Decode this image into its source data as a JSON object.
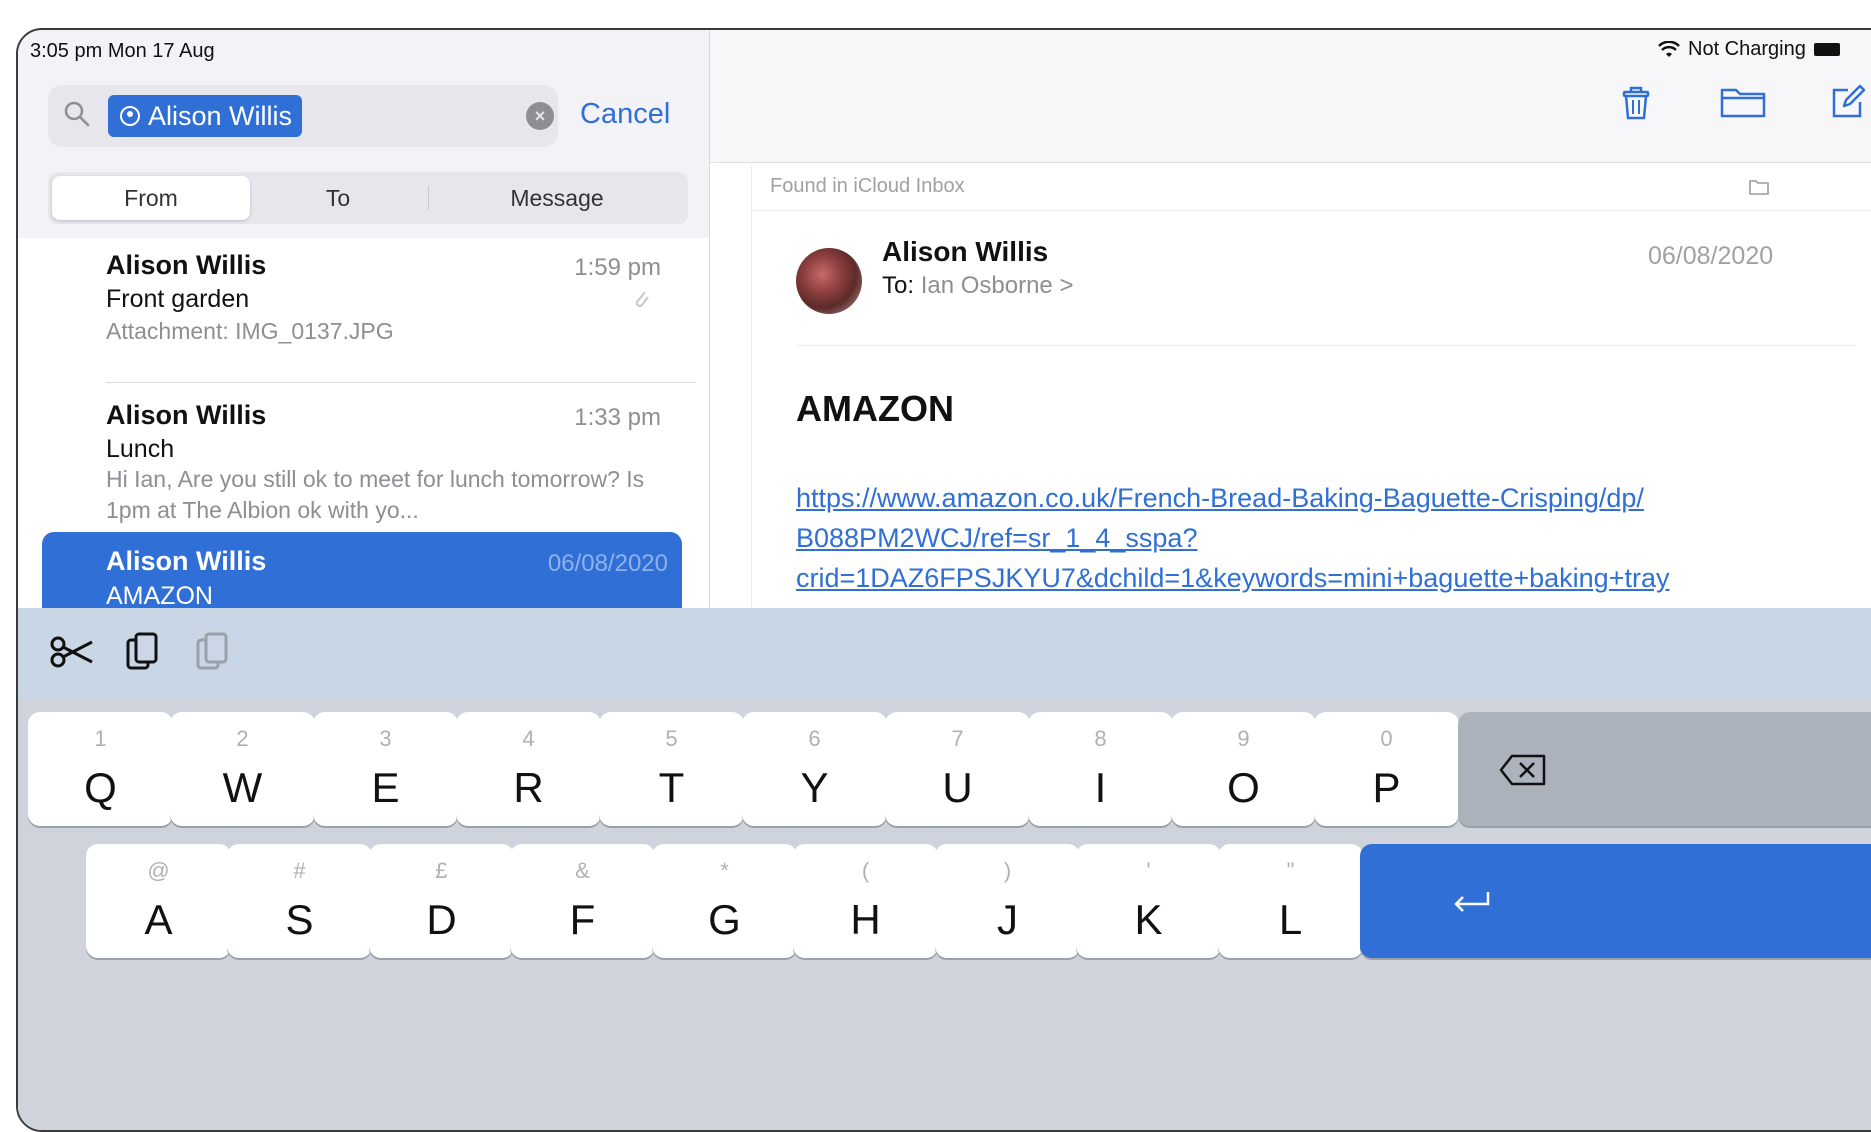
{
  "status_bar": {
    "time_date": "3:05 pm  Mon 17 Aug",
    "battery_text": "Not Charging"
  },
  "search": {
    "token_label": "Alison Willis",
    "cancel_label": "Cancel",
    "scopes": [
      "From",
      "To",
      "Message"
    ],
    "active_scope": "From"
  },
  "messages": [
    {
      "sender": "Alison Willis",
      "time": "1:59 pm",
      "subject": "Front garden",
      "preview": "Attachment: IMG_0137.JPG",
      "has_attachment": true
    },
    {
      "sender": "Alison Willis",
      "time": "1:33 pm",
      "subject": "Lunch",
      "preview": "Hi Ian, Are you still ok to meet for lunch tomorrow? Is 1pm at The Albion ok with yo..."
    },
    {
      "sender": "Alison Willis",
      "time": "06/08/2020",
      "subject": "AMAZON",
      "selected": true
    }
  ],
  "toolbar_icons": [
    "trash-icon",
    "folder-icon",
    "compose-icon"
  ],
  "mail": {
    "found_in": "Found in iCloud Inbox",
    "from": "Alison Willis",
    "to_label": "To:",
    "to_value": "Ian Osborne >",
    "date": "06/08/2020",
    "subject": "AMAZON",
    "link_line1": "https://www.amazon.co.uk/French-Bread-Baking-Baguette-Crisping/dp/",
    "link_line2": "B088PM2WCJ/ref=sr_1_4_sspa?",
    "link_line3": "crid=1DAZ6FPSJKYU7&dchild=1&keywords=mini+baguette+baking+tray"
  },
  "keyboard": {
    "row1": [
      {
        "num": "1",
        "letter": "Q"
      },
      {
        "num": "2",
        "letter": "W"
      },
      {
        "num": "3",
        "letter": "E"
      },
      {
        "num": "4",
        "letter": "R"
      },
      {
        "num": "5",
        "letter": "T"
      },
      {
        "num": "6",
        "letter": "Y"
      },
      {
        "num": "7",
        "letter": "U"
      },
      {
        "num": "8",
        "letter": "I"
      },
      {
        "num": "9",
        "letter": "O"
      },
      {
        "num": "0",
        "letter": "P"
      }
    ],
    "row2": [
      {
        "num": "@",
        "letter": "A"
      },
      {
        "num": "#",
        "letter": "S"
      },
      {
        "num": "£",
        "letter": "D"
      },
      {
        "num": "&",
        "letter": "F"
      },
      {
        "num": "*",
        "letter": "G"
      },
      {
        "num": "(",
        "letter": "H"
      },
      {
        "num": ")",
        "letter": "J"
      },
      {
        "num": "'",
        "letter": "K"
      },
      {
        "num": "\"",
        "letter": "L"
      }
    ]
  },
  "colors": {
    "accent": "#2f6fd6",
    "keyboard_bg": "#cfd4dc"
  }
}
